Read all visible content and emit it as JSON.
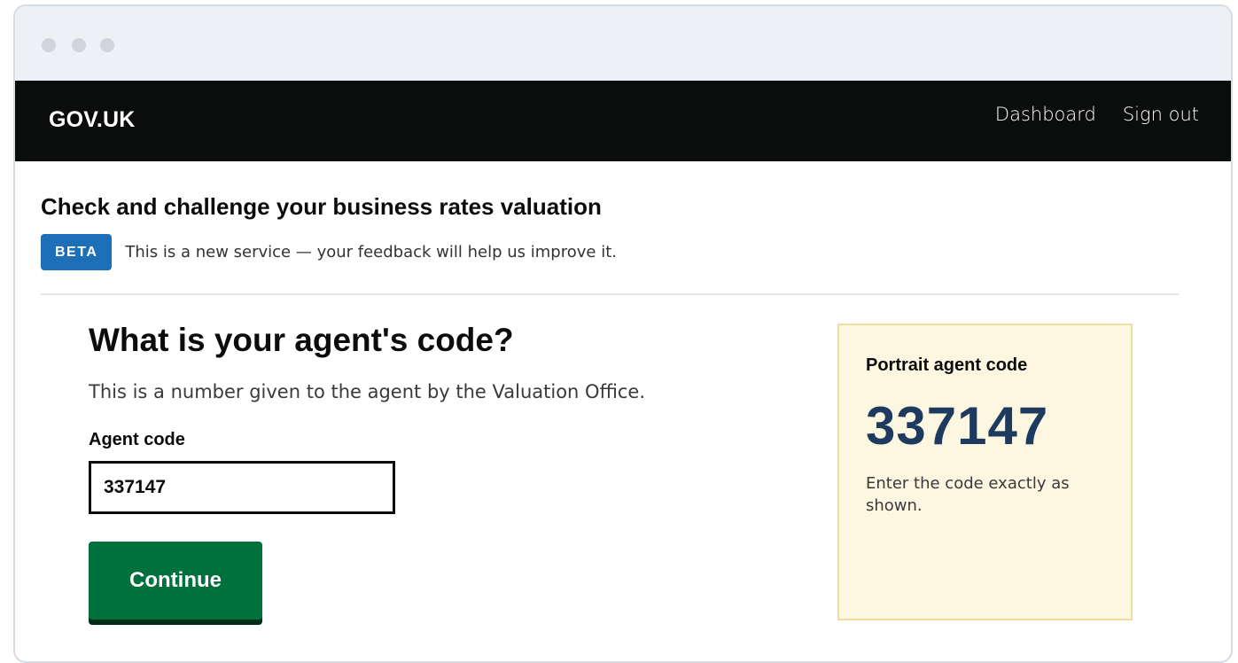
{
  "header": {
    "logo": "GOV.UK",
    "nav": [
      "Dashboard",
      "Sign out"
    ]
  },
  "service": {
    "title": "Check and challenge your business rates valuation",
    "phase_tag": "BETA",
    "phase_text": "This is a new service — your feedback will help us improve it."
  },
  "form": {
    "heading": "What is your agent's code?",
    "hint": "This is a number given to the agent by the Valuation Office.",
    "label": "Agent code",
    "value": "337147",
    "button": "Continue"
  },
  "panel": {
    "title": "Portrait agent code",
    "code": "337147",
    "note": "Enter the code exactly as shown."
  },
  "colors": {
    "header_bg": "#0b0c0c",
    "tag_bg": "#1d70b8",
    "button_bg": "#00703c",
    "panel_bg": "#fdf6e0",
    "code_color": "#1f3a5f"
  }
}
